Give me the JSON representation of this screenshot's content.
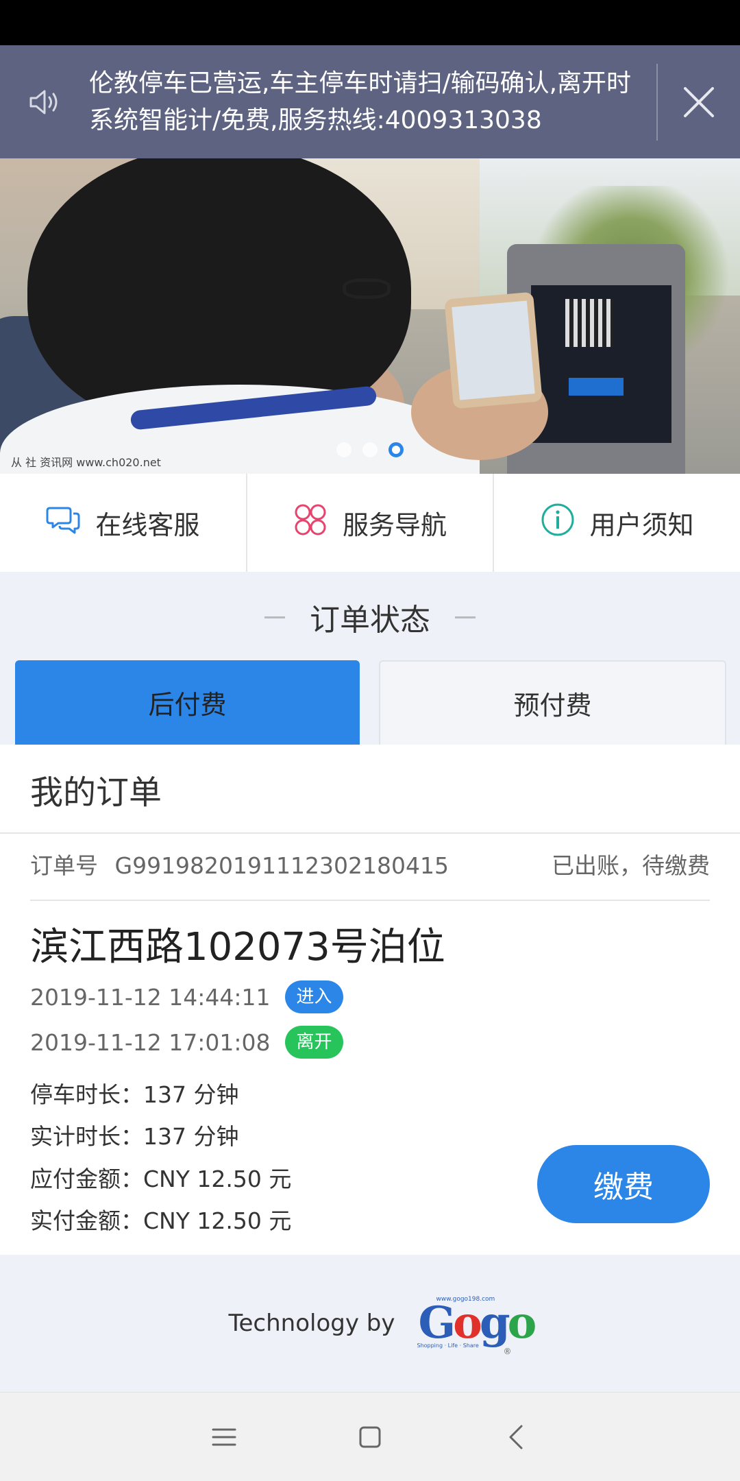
{
  "notice": {
    "text": "伦教停车已营运,车主停车时请扫/输码确认,离开时系统智能计/免费,服务热线:4009313038",
    "icon": "speaker-icon",
    "close_icon": "close-icon"
  },
  "banner": {
    "watermark": "从 社 资讯网  www.ch020.net",
    "slide_count": 3,
    "active_slide": 3
  },
  "quick_links": [
    {
      "label": "在线客服",
      "icon": "chat-icon"
    },
    {
      "label": "服务导航",
      "icon": "grid-icon"
    },
    {
      "label": "用户须知",
      "icon": "info-icon"
    }
  ],
  "section": {
    "title": "订单状态"
  },
  "tabs": [
    {
      "label": "后付费",
      "active": true
    },
    {
      "label": "预付费",
      "active": false
    }
  ],
  "order": {
    "heading": "我的订单",
    "order_no_label": "订单号",
    "order_no": "G991982019111230218041​5",
    "status": "已出账，待缴费",
    "place": "滨江西路102073号泊位",
    "enter_time": "2019-11-12 14:44:11",
    "enter_badge": "进入",
    "leave_time": "2019-11-12 17:01:08",
    "leave_badge": "离开",
    "park_duration": "停车时长：137 分钟",
    "billed_duration": "实计时长：137 分钟",
    "amount_due": "应付金额：CNY 12.50 元",
    "amount_paid": "实付金额：CNY 12.50 元",
    "pay_button": "缴费"
  },
  "footer": {
    "tech_by": "Technology by",
    "logo_text_g": "G",
    "logo_text_o1": "o",
    "logo_text_g2": "g",
    "logo_text_o2": "o",
    "logo_url": "www.gogo198.com",
    "logo_tagline": "Shopping · Life · Share",
    "logo_reg": "®"
  },
  "colors": {
    "accent": "#2c86e8",
    "notice_bg": "#5d6380",
    "leave_badge": "#27c45b"
  }
}
